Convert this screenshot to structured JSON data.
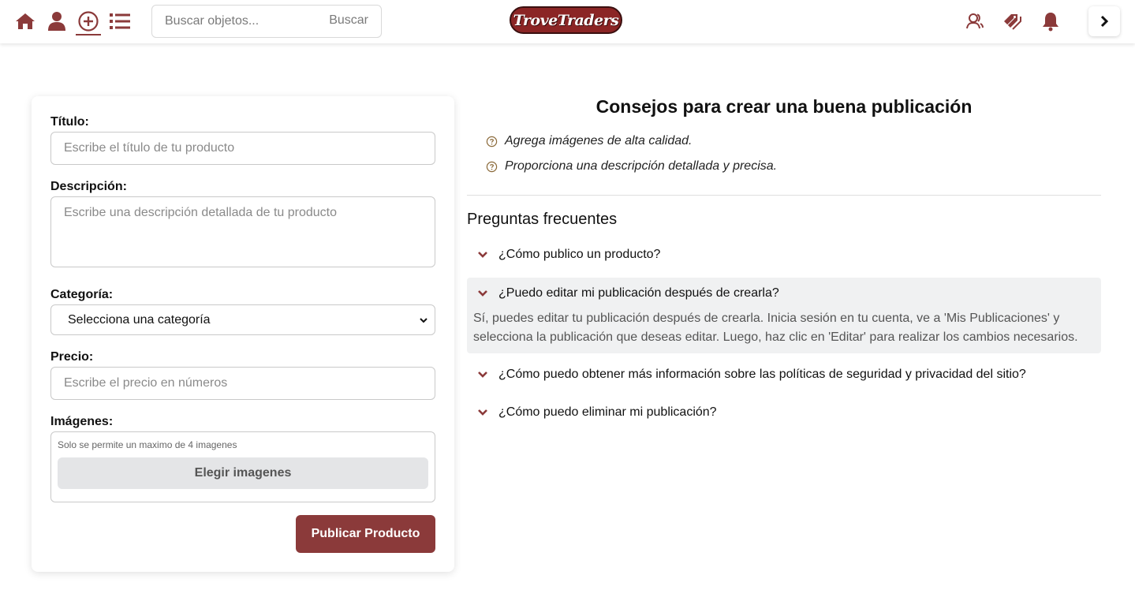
{
  "nav": {
    "icons": [
      "home-icon",
      "user-icon",
      "add-circle-icon",
      "list-icon"
    ],
    "search_placeholder": "Buscar objetos...",
    "search_button": "Buscar",
    "logo_text": "TroveTraders",
    "right_icons": [
      "users-icon",
      "tag-icon",
      "bell-icon",
      "chevron-right-icon"
    ]
  },
  "colors": {
    "accent": "#8b3a3a",
    "logo_bg": "#8b2525",
    "tip_icon": "#8b6a3a"
  },
  "form": {
    "title_label": "Título:",
    "title_placeholder": "Escribe el título de tu producto",
    "desc_label": "Descripción:",
    "desc_placeholder": "Escribe una descripción detallada de tu producto",
    "category_label": "Categoría:",
    "category_selected": "Selecciona una categoría",
    "price_label": "Precio:",
    "price_placeholder": "Escribe el precio en números",
    "images_label": "Imágenes:",
    "images_note": "Solo se permite un maximo de 4 imagenes",
    "images_button": "Elegir imagenes",
    "submit_button": "Publicar Producto"
  },
  "tips": {
    "title": "Consejos para crear una buena publicación",
    "items": [
      "Agrega imágenes de alta calidad.",
      "Proporciona una descripción detallada y precisa."
    ]
  },
  "faq": {
    "title": "Preguntas frecuentes",
    "items": [
      {
        "question": "¿Cómo publico un producto?"
      },
      {
        "question": "¿Puedo editar mi publicación después de crearla?",
        "answer": "Sí, puedes editar tu publicación después de crearla. Inicia sesión en tu cuenta, ve a 'Mis Publicaciones' y selecciona la publicación que deseas editar. Luego, haz clic en 'Editar' para realizar los cambios necesarios."
      },
      {
        "question": "¿Cómo puedo obtener más información sobre las políticas de seguridad y privacidad del sitio?"
      },
      {
        "question": "¿Cómo puedo eliminar mi publicación?"
      }
    ]
  }
}
